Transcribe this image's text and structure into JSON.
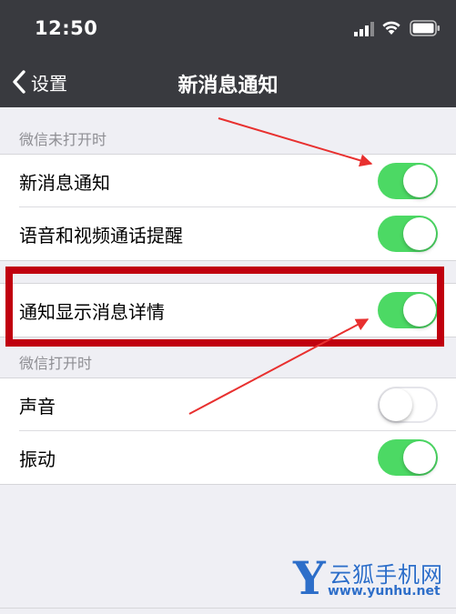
{
  "status_bar": {
    "time": "12:50"
  },
  "nav": {
    "back_label": "设置",
    "title": "新消息通知"
  },
  "sections": [
    {
      "header": "微信未打开时",
      "rows": [
        {
          "label": "新消息通知",
          "enabled": true
        },
        {
          "label": "语音和视频通话提醒",
          "enabled": true
        }
      ]
    },
    {
      "rows": [
        {
          "label": "通知显示消息详情",
          "enabled": true
        }
      ]
    },
    {
      "header": "微信打开时",
      "rows": [
        {
          "label": "声音",
          "enabled": false
        },
        {
          "label": "振动",
          "enabled": true
        }
      ]
    }
  ],
  "colors": {
    "bar": "#393a3f",
    "toggle_on": "#4cd964",
    "annotation": "#c0000f",
    "background": "#efeff4"
  },
  "icons": [
    "cellular-signal-icon",
    "wifi-icon",
    "battery-icon",
    "chevron-left-icon"
  ],
  "watermark": {
    "letter": "Y",
    "name": "云狐手机网",
    "url": "www.yunhu.net"
  }
}
